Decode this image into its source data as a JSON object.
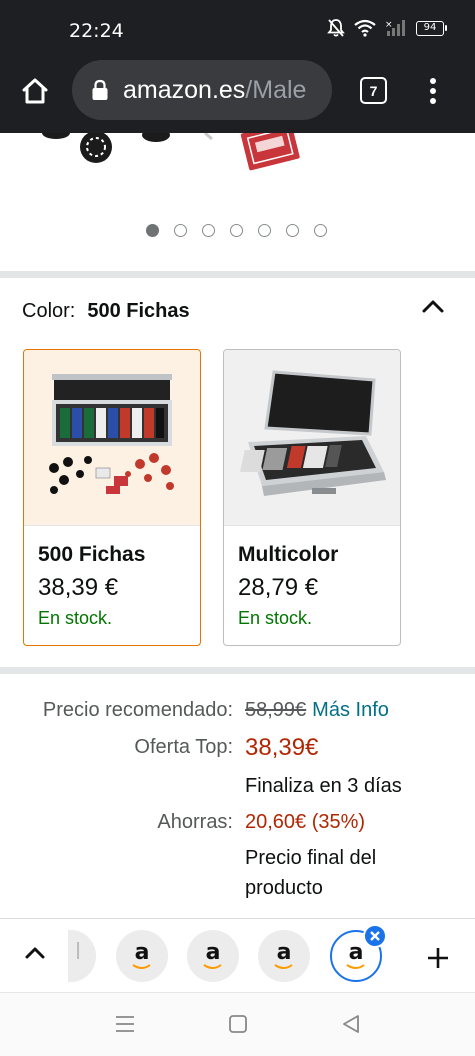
{
  "status_bar": {
    "time": "22:24",
    "battery_level": "94",
    "icons": [
      "mute-bell-icon",
      "wifi-icon",
      "signal-icon",
      "battery-icon"
    ]
  },
  "browser": {
    "url_domain": "amazon.es",
    "url_path": "/Male",
    "tab_count": "7",
    "icons": [
      "home-icon",
      "lock-icon",
      "overflow-menu-icon"
    ]
  },
  "carousel": {
    "dot_count": 7,
    "active_index": 0
  },
  "color_selector": {
    "label": "Color:",
    "selected_value": "500 Fichas",
    "options": [
      {
        "name": "500 Fichas",
        "price": "38,39 €",
        "stock": "En stock.",
        "selected": true
      },
      {
        "name": "Multicolor",
        "price": "28,79 €",
        "stock": "En stock.",
        "selected": false
      }
    ]
  },
  "pricing": {
    "recommended_label": "Precio recomendado:",
    "recommended_value": "58,99€",
    "more_info": "Más Info",
    "deal_label": "Oferta Top:",
    "deal_value": "38,39€",
    "deal_ends": "Finaliza en 3 días",
    "savings_label": "Ahorras:",
    "savings_value": "20,60€ (35%)",
    "final_price_line1": "Precio final del",
    "final_price_line2": "producto"
  },
  "tab_strip": {
    "tab_letter": "a",
    "partial_tab_letter": "l",
    "icons": [
      "chevron-up-icon",
      "close-icon",
      "plus-icon"
    ]
  },
  "colors": {
    "chrome_bg": "#1e1f22",
    "selected_border": "#e77600",
    "price_red": "#b12704",
    "stock_green": "#007600",
    "link_teal": "#007185",
    "active_tab_blue": "#1a73e8"
  }
}
